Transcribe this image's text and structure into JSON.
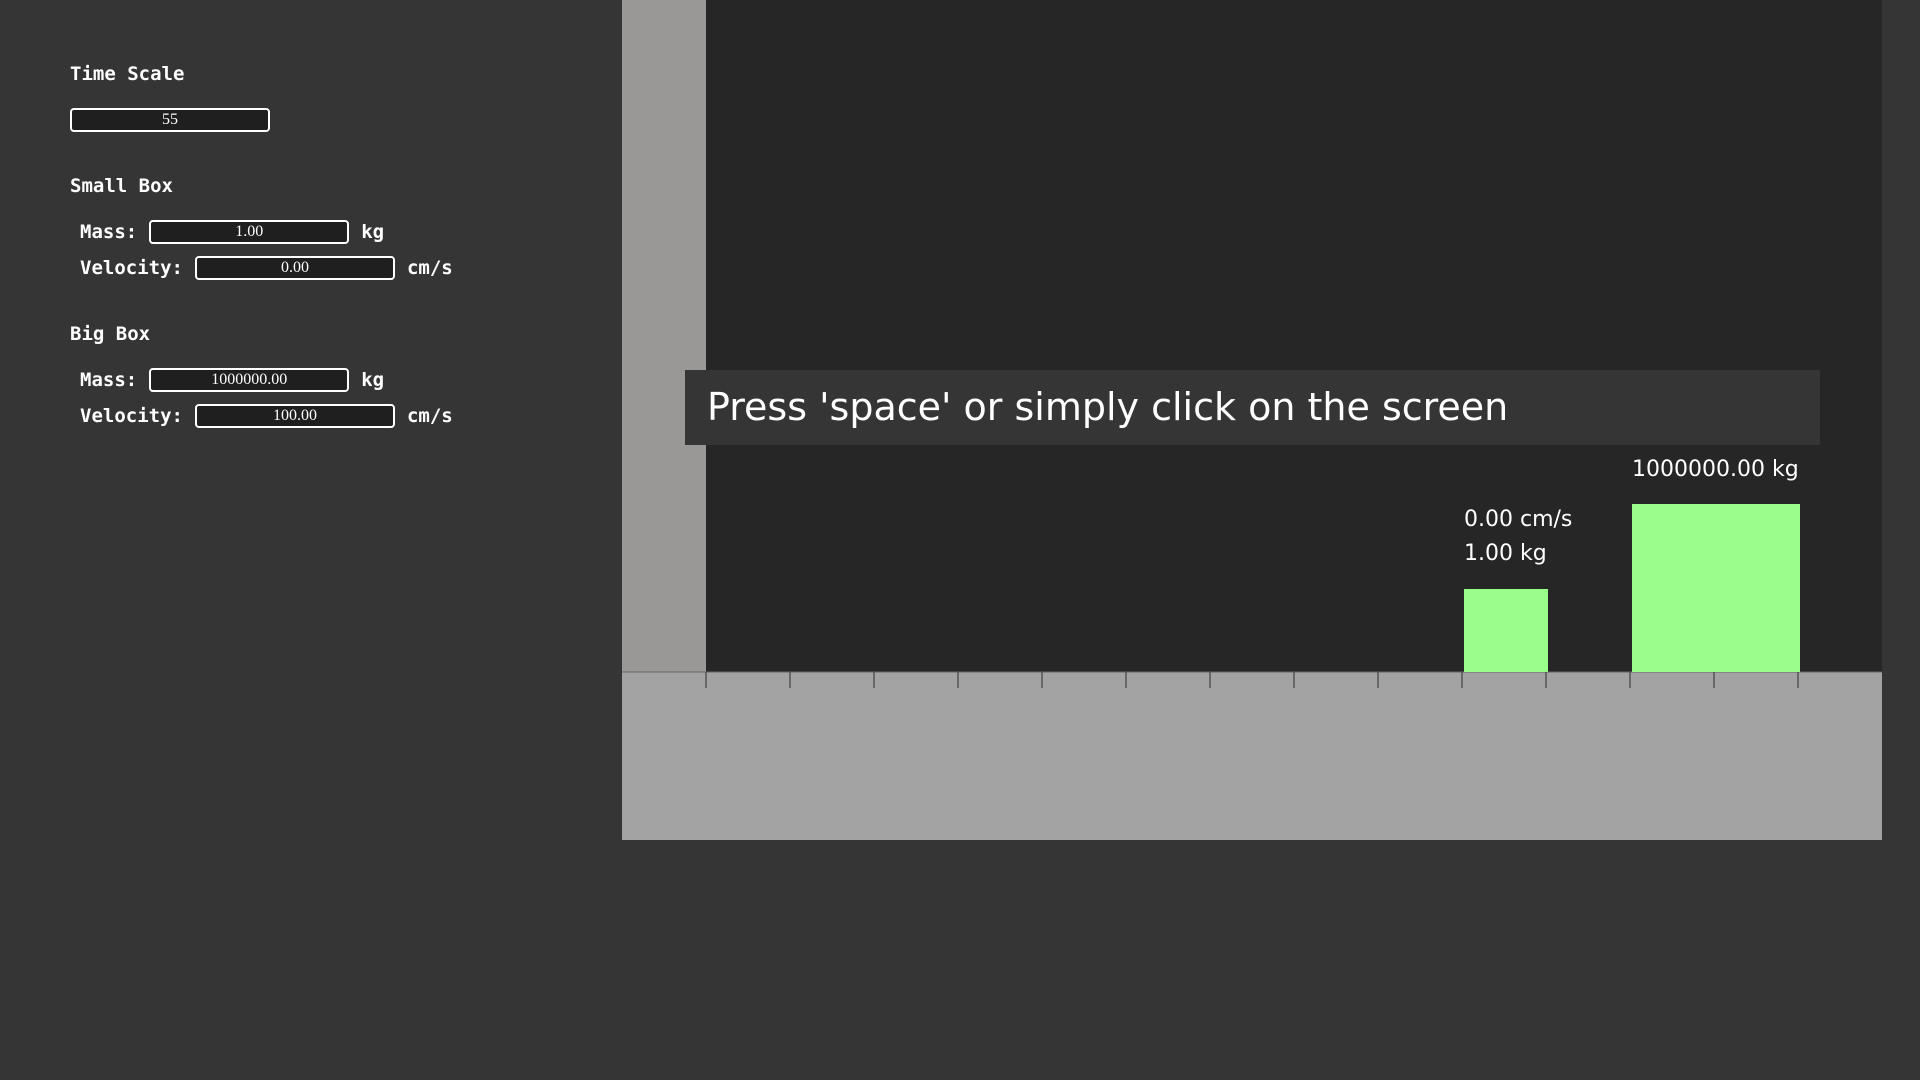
{
  "controls": {
    "time_scale": {
      "title": "Time Scale",
      "value": "55"
    },
    "small_box": {
      "title": "Small Box",
      "mass_label": "Mass:",
      "mass_value": "1.00",
      "mass_unit": "kg",
      "velocity_label": "Velocity:",
      "velocity_value": "0.00",
      "velocity_unit": "cm/s"
    },
    "big_box": {
      "title": "Big Box",
      "mass_label": "Mass:",
      "mass_value": "1000000.00",
      "mass_unit": "kg",
      "velocity_label": "Velocity:",
      "velocity_value": "100.00",
      "velocity_unit": "cm/s"
    }
  },
  "simulation": {
    "small_box_label": {
      "velocity": "0.00 cm/s",
      "mass": "1.00 kg"
    },
    "big_box_label": {
      "mass": "1000000.00 kg"
    },
    "banner": "Press 'space' or simply click on the screen",
    "colors": {
      "background": "#262626",
      "wall": "#999896",
      "floor": "#a3a3a3",
      "box": "#99ff8a",
      "panel": "#353535"
    }
  }
}
